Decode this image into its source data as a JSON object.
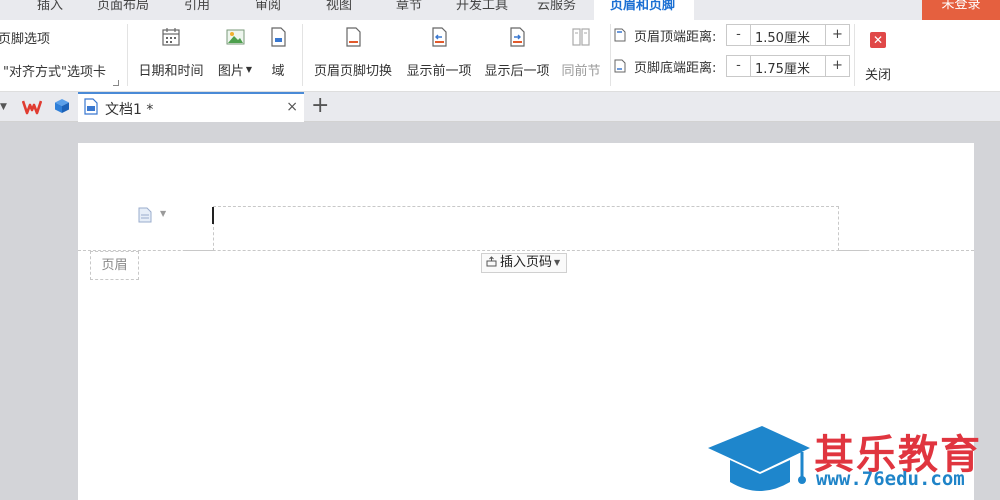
{
  "menu": {
    "tabs": [
      "插入",
      "页面布局",
      "引用",
      "审阅",
      "视图",
      "章节",
      "开发工具",
      "云服务",
      "页眉和页脚"
    ],
    "active": "页眉和页脚",
    "login": "未登录"
  },
  "ribbon": {
    "footer_options": "页脚选项",
    "align_tab": "\"对齐方式\"选项卡",
    "date_time": "日期和时间",
    "picture": "图片",
    "field": "域",
    "switch": "页眉页脚切换",
    "show_prev": "显示前一项",
    "show_next": "显示后一项",
    "same_prev": "同前节",
    "header_top_label": "页眉顶端距离:",
    "header_top_value": "1.50厘米",
    "footer_bottom_label": "页脚底端距离:",
    "footer_bottom_value": "1.75厘米",
    "minus": "-",
    "plus": "+",
    "close": "关闭"
  },
  "tabstrip": {
    "doc_name": "文档1 *",
    "close": "×",
    "new_tab": "+"
  },
  "document": {
    "header_label": "页眉",
    "insert_page_number": "插入页码"
  },
  "watermark": {
    "brand": "其乐教育",
    "url": "www.76edu.com"
  },
  "colors": {
    "accent": "#1b6fd3",
    "login_bg": "#e5603f",
    "watermark_red": "#e0353f",
    "watermark_blue": "#1f84c8"
  }
}
